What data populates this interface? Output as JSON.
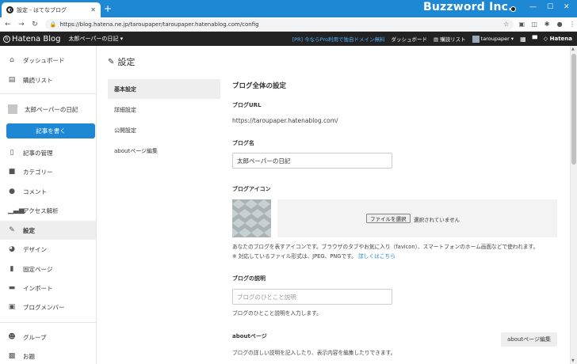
{
  "browser": {
    "tab_title": "設定 - はてなブログ",
    "tab_favicon": "hatena-favicon",
    "new_tab": "+",
    "brand": "Buzzword Inc.",
    "url": "https://blog.hatena.ne.jp/taroupaper/taroupaper.hatenablog.com/config",
    "url_display": "https://blog.hatena.ne.jp/taroupaper/taroupaper.hatenablog.com/config",
    "win_min": "—",
    "win_max": "☐",
    "win_close": "✕"
  },
  "hatena_header": {
    "logo": "Hatena Blog",
    "blog_selector": "太郎ペーパーの日記 ▾",
    "promo": "[PR] 今ならPro利用で独自ドメイン無料",
    "dashboard": "ダッシュボード",
    "reading_list": "購読リスト",
    "user": "taroupaper ▾",
    "hatena": "◇ Hatena"
  },
  "sidebar": {
    "items": [
      {
        "label": "ダッシュボード",
        "icon": "home-icon"
      },
      {
        "label": "購読リスト",
        "icon": "reader-icon"
      }
    ],
    "blog_name": "太郎ペーパーの日記",
    "write_button": "記事を書く",
    "menu": [
      {
        "label": "記事の管理",
        "icon": "document-icon"
      },
      {
        "label": "カテゴリー",
        "icon": "folder-icon"
      },
      {
        "label": "コメント",
        "icon": "comment-icon"
      },
      {
        "label": "アクセス解析",
        "icon": "analytics-icon"
      },
      {
        "label": "設定",
        "icon": "wrench-icon",
        "active": true
      },
      {
        "label": "デザイン",
        "icon": "palette-icon"
      },
      {
        "label": "固定ページ",
        "icon": "page-icon"
      },
      {
        "label": "インポート",
        "icon": "import-icon"
      },
      {
        "label": "ブログメンバー",
        "icon": "members-icon"
      }
    ],
    "bottom": [
      {
        "label": "グループ",
        "icon": "group-icon"
      },
      {
        "label": "お題",
        "icon": "topic-icon"
      }
    ]
  },
  "page": {
    "title": "設定"
  },
  "subnav": {
    "items": [
      "基本設定",
      "詳細設定",
      "公開設定",
      "aboutページ編集"
    ],
    "active_index": 0
  },
  "settings": {
    "section_title": "ブログ全体の設定",
    "url_label": "ブログURL",
    "url_value": "https://taroupaper.hatenablog.com/",
    "name_label": "ブログ名",
    "name_value": "太郎ペーパーの日記",
    "icon_label": "ブログアイコン",
    "file_button": "ファイルを選択",
    "file_status": "選択されていません",
    "icon_help": "あなたのブログを表すアイコンです。ブラウザのタブやお気に入り（favicon）、スマートフォンのホーム画面などで使われます。",
    "icon_help2": "※ 対応しているファイル形式は、JPEG、PNGです。",
    "icon_help_link": "詳しくはこちら",
    "desc_label": "ブログの説明",
    "desc_placeholder": "ブログのひとこと説明",
    "desc_help": "ブログのひとこと説明を入力します。",
    "about_label": "aboutページ",
    "about_help": "ブログの詳しい説明を記入したり、表示内容を編集したりできます。",
    "about_button": "aboutページ編集"
  }
}
